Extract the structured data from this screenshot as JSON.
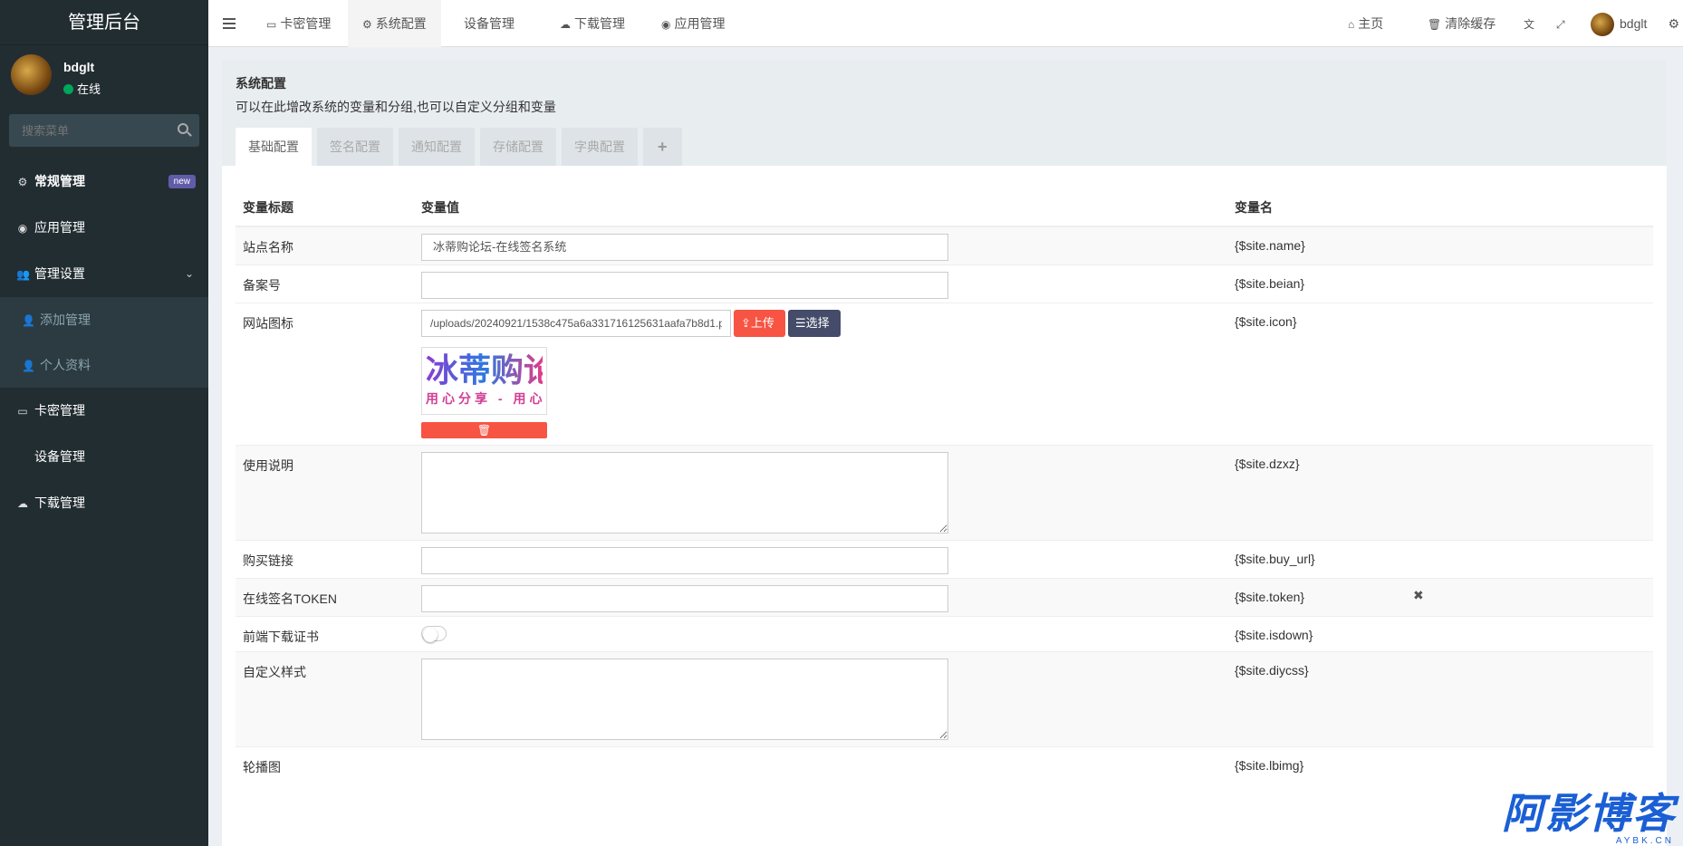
{
  "sidebar": {
    "logo": "管理后台",
    "user_name": "bdglt",
    "user_status": "在线",
    "search_placeholder": "搜索菜单",
    "items": [
      {
        "label": "常规管理",
        "icon": "cogs-icon",
        "glyph": "⚙",
        "badge": "new"
      },
      {
        "label": "应用管理",
        "icon": "app-icon",
        "glyph": "◉"
      },
      {
        "label": "管理设置",
        "icon": "users-icon",
        "glyph": "👥",
        "chevron": "⌄"
      },
      {
        "label": "添加管理",
        "icon": "user-icon",
        "glyph": "👤"
      },
      {
        "label": "个人资料",
        "icon": "user-icon",
        "glyph": "👤"
      },
      {
        "label": "卡密管理",
        "icon": "card-icon",
        "glyph": "▭"
      },
      {
        "label": "设备管理",
        "icon": "apple-icon",
        "glyph": ""
      },
      {
        "label": "下载管理",
        "icon": "cloud-download-icon",
        "glyph": "☁"
      }
    ]
  },
  "topnav": {
    "tabs": [
      {
        "label": "卡密管理",
        "glyph": "▭"
      },
      {
        "label": "系统配置",
        "glyph": "⚙"
      },
      {
        "label": "设备管理",
        "glyph": ""
      },
      {
        "label": "下载管理",
        "glyph": "☁"
      },
      {
        "label": "应用管理",
        "glyph": "◉"
      }
    ],
    "home": "主页",
    "home_glyph": "⌂",
    "clear_cache": "清除缓存",
    "clear_glyph": "🗑",
    "translate_glyph": "文",
    "fullscreen_glyph": "⤢",
    "user": "bdglt",
    "settings_glyph": "⚙"
  },
  "panel": {
    "title": "系统配置",
    "subtitle": "可以在此增改系统的变量和分组,也可以自定义分组和变量",
    "tabs": [
      "基础配置",
      "签名配置",
      "通知配置",
      "存储配置",
      "字典配置",
      "+"
    ]
  },
  "table": {
    "headers": {
      "title": "变量标题",
      "value": "变量值",
      "name": "变量名"
    },
    "rows": {
      "site_name": {
        "label": "站点名称",
        "value": "冰蒂购论坛-在线签名系统",
        "var": "{$site.name}"
      },
      "beian": {
        "label": "备案号",
        "value": "",
        "var": "{$site.beian}"
      },
      "icon": {
        "label": "网站图标",
        "value": "/uploads/20240921/1538c475a6a331716125631aafa7b8d1.png",
        "var": "{$site.icon}",
        "upload": "上传",
        "choose": "选择",
        "upload_glyph": "⇪",
        "choose_glyph": "☰",
        "delete_glyph": "🗑",
        "preview_line1": "冰蒂购论",
        "preview_line2": "用心分享 - 用心"
      },
      "dzxz": {
        "label": "使用说明",
        "value": "",
        "var": "{$site.dzxz}"
      },
      "buy_url": {
        "label": "购买链接",
        "value": "",
        "var": "{$site.buy_url}"
      },
      "token": {
        "label": "在线签名TOKEN",
        "value": "",
        "var": "{$site.token}",
        "close": "✖"
      },
      "isdown": {
        "label": "前端下载证书",
        "var": "{$site.isdown}",
        "enabled": false
      },
      "diycss": {
        "label": "自定义样式",
        "value": "",
        "var": "{$site.diycss}"
      },
      "lbimg": {
        "label": "轮播图",
        "var": "{$site.lbimg}"
      }
    }
  },
  "watermark": {
    "main": "阿影博客",
    "sub": "AYBK.CN"
  }
}
